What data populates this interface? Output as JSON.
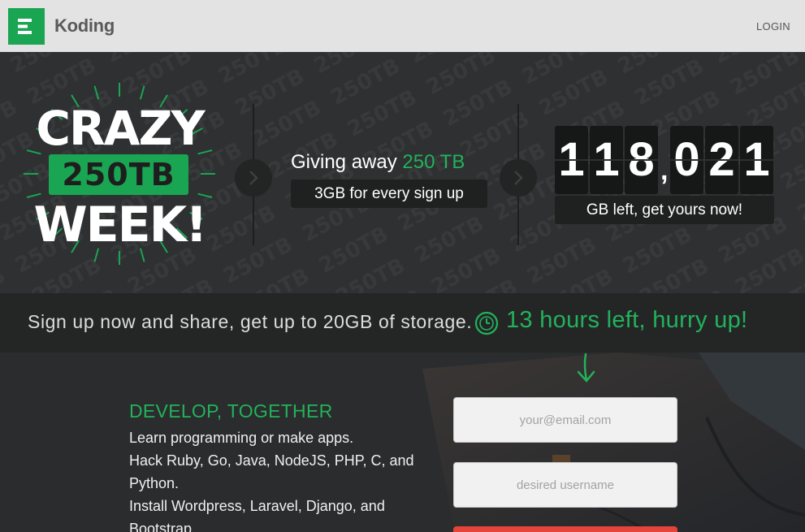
{
  "header": {
    "logo_icon": "koding-logo-icon",
    "brand": "Koding",
    "login": "LOGIN"
  },
  "colors": {
    "accent": "#1aa553",
    "accent_text": "#22b25b",
    "danger": "#e5443b",
    "hero_bg": "#2e3031"
  },
  "hero": {
    "badge": {
      "line1": "CRAZY",
      "line2": "250TB",
      "line3": "WEEK!"
    },
    "giving_prefix": "Giving away ",
    "giving_amount": "250 TB",
    "per_signup": "3GB for every sign up",
    "counter": {
      "digits": [
        "1",
        "1",
        "8",
        "0",
        "2",
        "1"
      ],
      "separator": ",",
      "value": 118021
    },
    "counter_caption": "GB left, get yours now!",
    "pattern_text": "250TB"
  },
  "strip": {
    "text": "Sign up now and share, get up to 20GB of storage.",
    "hurry": "13 hours left, hurry up!"
  },
  "develop": {
    "title": "DEVELOP, TOGETHER",
    "lines": [
      "Learn programming or make apps.",
      "Hack Ruby, Go, Java, NodeJS, PHP, C, and",
      "Python.",
      "Install Wordpress, Laravel, Django, and",
      "Bootstrap."
    ]
  },
  "form": {
    "email_placeholder": "your@email.com",
    "username_placeholder": "desired username"
  }
}
